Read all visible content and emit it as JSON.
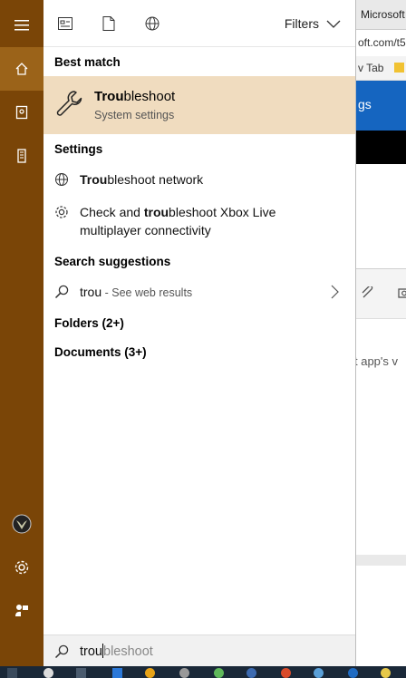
{
  "toolbar": {
    "filters_label": "Filters"
  },
  "sections": {
    "best_match": "Best match",
    "settings": "Settings",
    "search_suggestions": "Search suggestions",
    "folders": "Folders (2+)",
    "documents": "Documents (3+)"
  },
  "best_match": {
    "title_bold": "Trou",
    "title_rest": "bleshoot",
    "subtitle": "System settings"
  },
  "settings_items": [
    {
      "bold": "Trou",
      "rest": "bleshoot network"
    },
    {
      "prefix": "Check and ",
      "bold": "trou",
      "rest": "bleshoot Xbox Live",
      "line2": "multiplayer connectivity"
    }
  ],
  "suggestion": {
    "query": "trou",
    "hint": " - See web results"
  },
  "search": {
    "typed": "trou",
    "ghost": "bleshoot"
  },
  "browser": {
    "tab_title": "Microsoft",
    "url_fragment": "oft.com/t5",
    "bookmark": "v Tab",
    "blue_text": "gs",
    "body_text": "t  app's v"
  },
  "colors": {
    "rail": "#7a4507",
    "rail_active": "#9b6319",
    "highlight": "#f0dcbf",
    "taskbar": "#1a2838"
  }
}
